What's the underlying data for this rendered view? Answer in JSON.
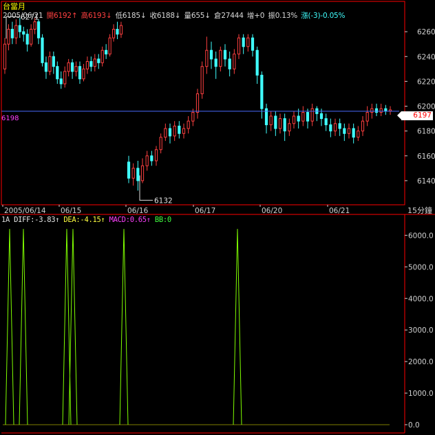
{
  "window": {
    "title": "台當月"
  },
  "info": {
    "date": "2005/06/21",
    "open": "開6192↑",
    "high": "高6193↓",
    "low": "低6185↓",
    "close": "收6188↓",
    "volume": "量655↓",
    "oi": "倉27444",
    "oi_change": "增+0",
    "amplitude": "振0.13%",
    "change": "漲(-3)-0.05%"
  },
  "price_axis": {
    "ticks": [
      "6260",
      "6240",
      "6220",
      "6200",
      "6180",
      "6160",
      "6140"
    ]
  },
  "markers": {
    "high_label": "6271",
    "low_label": "6132",
    "last_price": "6197",
    "crosshair_price": "6198"
  },
  "dates": [
    "2005/06/14",
    "06/15",
    "06/16",
    "06/17",
    "06/20",
    "06/21"
  ],
  "period_label": "15分鐘",
  "macd": {
    "prefix": "1A",
    "diff": "DIFF:-3.83↑",
    "dea": "DEA:-4.15↑",
    "macd": "MACD:0.65↑",
    "bb": "BB:0"
  },
  "volume_axis": {
    "ticks": [
      "6000.0",
      "5000.0",
      "4000.0",
      "3000.0",
      "2000.0",
      "1000.0",
      "0.0"
    ]
  },
  "colors": {
    "background": "#000000",
    "up_candle": "#ff4040",
    "down_candle": "#40ffff",
    "grid_border": "#ff0000",
    "crosshair": "#4a6bff",
    "indicator_line": "#80ff00"
  },
  "chart_data": {
    "type": "candlestick",
    "ylim": [
      6125,
      6280
    ],
    "high": 6271,
    "low": 6132,
    "last": 6197,
    "candles": [
      [
        6230,
        6250,
        6226,
        6255
      ],
      [
        6250,
        6262,
        6245,
        6266
      ],
      [
        6262,
        6255,
        6250,
        6268
      ],
      [
        6255,
        6265,
        6250,
        6270
      ],
      [
        6265,
        6260,
        6255,
        6271
      ],
      [
        6260,
        6258,
        6252,
        6264
      ],
      [
        6258,
        6250,
        6244,
        6262
      ],
      [
        6250,
        6262,
        6248,
        6266
      ],
      [
        6262,
        6268,
        6258,
        6271
      ],
      [
        6268,
        6255,
        6250,
        6270
      ],
      [
        6255,
        6235,
        6232,
        6258
      ],
      [
        6235,
        6228,
        6222,
        6240
      ],
      [
        6228,
        6240,
        6225,
        6244
      ],
      [
        6240,
        6232,
        6226,
        6244
      ],
      [
        6232,
        6222,
        6218,
        6236
      ],
      [
        6222,
        6218,
        6214,
        6228
      ],
      [
        6218,
        6228,
        6215,
        6232
      ],
      [
        6228,
        6235,
        6224,
        6238
      ],
      [
        6235,
        6228,
        6222,
        6238
      ],
      [
        6228,
        6232,
        6224,
        6236
      ],
      [
        6232,
        6222,
        6218,
        6236
      ],
      [
        6222,
        6230,
        6220,
        6234
      ],
      [
        6230,
        6236,
        6226,
        6240
      ],
      [
        6236,
        6232,
        6228,
        6240
      ],
      [
        6232,
        6238,
        6228,
        6242
      ],
      [
        6238,
        6235,
        6230,
        6242
      ],
      [
        6235,
        6245,
        6232,
        6248
      ],
      [
        6245,
        6242,
        6238,
        6250
      ],
      [
        6242,
        6255,
        6240,
        6258
      ],
      [
        6255,
        6262,
        6252,
        6266
      ],
      [
        6262,
        6258,
        6254,
        6268
      ],
      [
        6258,
        6265,
        6255,
        6268
      ],
      [
        6155,
        6142,
        6138,
        6160
      ],
      [
        6142,
        6150,
        6136,
        6154
      ],
      [
        6150,
        6140,
        6132,
        6156
      ],
      [
        6140,
        6152,
        6138,
        6158
      ],
      [
        6152,
        6160,
        6148,
        6164
      ],
      [
        6160,
        6156,
        6152,
        6164
      ],
      [
        6156,
        6165,
        6152,
        6168
      ],
      [
        6165,
        6175,
        6162,
        6178
      ],
      [
        6175,
        6182,
        6172,
        6186
      ],
      [
        6182,
        6176,
        6170,
        6186
      ],
      [
        6176,
        6184,
        6172,
        6188
      ],
      [
        6184,
        6178,
        6174,
        6188
      ],
      [
        6178,
        6182,
        6174,
        6186
      ],
      [
        6182,
        6188,
        6178,
        6192
      ],
      [
        6188,
        6195,
        6184,
        6198
      ],
      [
        6195,
        6210,
        6190,
        6214
      ],
      [
        6210,
        6232,
        6206,
        6236
      ],
      [
        6232,
        6245,
        6226,
        6256
      ],
      [
        6245,
        6238,
        6230,
        6252
      ],
      [
        6238,
        6232,
        6222,
        6244
      ],
      [
        6232,
        6245,
        6228,
        6248
      ],
      [
        6245,
        6238,
        6232,
        6250
      ],
      [
        6238,
        6230,
        6224,
        6244
      ],
      [
        6230,
        6242,
        6226,
        6246
      ],
      [
        6242,
        6255,
        6238,
        6258
      ],
      [
        6255,
        6248,
        6242,
        6258
      ],
      [
        6248,
        6255,
        6244,
        6258
      ],
      [
        6255,
        6245,
        6240,
        6258
      ],
      [
        6245,
        6225,
        6218,
        6248
      ],
      [
        6225,
        6198,
        6190,
        6228
      ],
      [
        6198,
        6185,
        6178,
        6202
      ],
      [
        6185,
        6192,
        6180,
        6196
      ],
      [
        6192,
        6182,
        6176,
        6196
      ],
      [
        6182,
        6190,
        6178,
        6194
      ],
      [
        6190,
        6180,
        6172,
        6194
      ],
      [
        6180,
        6186,
        6176,
        6190
      ],
      [
        6186,
        6192,
        6182,
        6196
      ],
      [
        6192,
        6188,
        6182,
        6198
      ],
      [
        6188,
        6195,
        6184,
        6200
      ],
      [
        6195,
        6188,
        6182,
        6198
      ],
      [
        6188,
        6198,
        6184,
        6202
      ],
      [
        6198,
        6194,
        6188,
        6200
      ],
      [
        6194,
        6190,
        6184,
        6198
      ],
      [
        6190,
        6185,
        6180,
        6194
      ],
      [
        6185,
        6180,
        6175,
        6190
      ],
      [
        6180,
        6186,
        6176,
        6190
      ],
      [
        6186,
        6182,
        6176,
        6190
      ],
      [
        6182,
        6178,
        6172,
        6186
      ],
      [
        6178,
        6182,
        6174,
        6186
      ],
      [
        6182,
        6175,
        6170,
        6186
      ],
      [
        6175,
        6180,
        6172,
        6184
      ],
      [
        6180,
        6188,
        6176,
        6192
      ],
      [
        6188,
        6195,
        6184,
        6200
      ],
      [
        6195,
        6198,
        6190,
        6202
      ],
      [
        6198,
        6195,
        6192,
        6202
      ],
      [
        6195,
        6198,
        6192,
        6202
      ],
      [
        6198,
        6196,
        6193,
        6201
      ],
      [
        6196,
        6197,
        6193,
        6200
      ]
    ],
    "indicator_spikes": [
      {
        "x": 14,
        "peak": 6200
      },
      {
        "x": 34,
        "peak": 6200
      },
      {
        "x": 97,
        "peak": 6200
      },
      {
        "x": 106,
        "peak": 6200
      },
      {
        "x": 180,
        "peak": 6200
      },
      {
        "x": 345,
        "peak": 6200
      }
    ]
  }
}
